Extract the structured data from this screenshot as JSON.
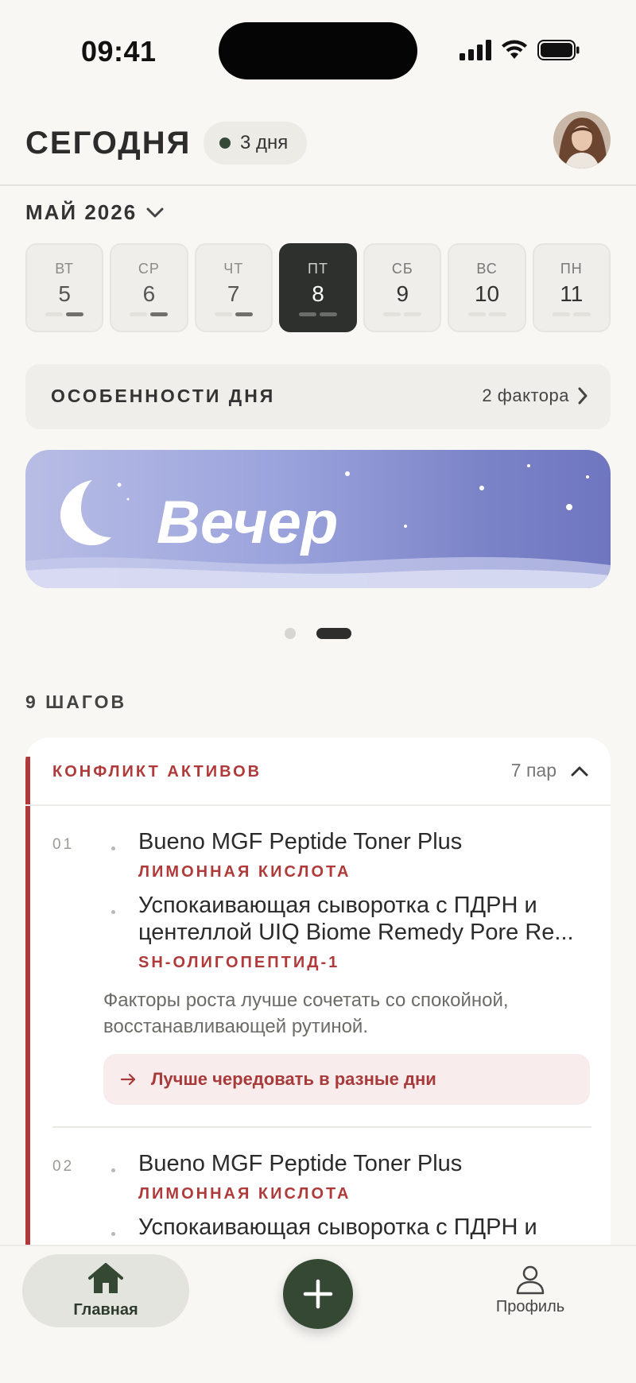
{
  "status_bar": {
    "time": "09:41"
  },
  "header": {
    "title": "СЕГОДНЯ",
    "streak": "3 дня"
  },
  "calendar": {
    "month": "МАЙ 2026",
    "days": [
      {
        "dow": "ВТ",
        "num": "5",
        "state": "past"
      },
      {
        "dow": "СР",
        "num": "6",
        "state": "past"
      },
      {
        "dow": "ЧТ",
        "num": "7",
        "state": "past"
      },
      {
        "dow": "ПТ",
        "num": "8",
        "state": "selected"
      },
      {
        "dow": "СБ",
        "num": "9",
        "state": "future"
      },
      {
        "dow": "ВС",
        "num": "10",
        "state": "future"
      },
      {
        "dow": "ПН",
        "num": "11",
        "state": "future"
      }
    ]
  },
  "features": {
    "label": "ОСОБЕННОСТИ ДНЯ",
    "count": "2 фактора"
  },
  "banner": {
    "title": "Вечер"
  },
  "pager": {
    "total": 2,
    "active": 2
  },
  "steps": {
    "label": "9 ШАГОВ",
    "conflict": {
      "label": "КОНФЛИКТ АКТИВОВ",
      "pairs": "7 пар",
      "items": [
        {
          "num": "01",
          "product_a": "Bueno MGF Peptide Toner Plus",
          "ingredient_a": "ЛИМОННАЯ КИСЛОТА",
          "product_b_line1": "Успокаивающая сыворотка с ПДРН и",
          "product_b_line2": "центеллой UIQ Biome Remedy Pore Re...",
          "ingredient_b": "SH-ОЛИГОПЕПТИД-1",
          "note_line1": "Факторы роста лучше сочетать со спокойной,",
          "note_line2": "восстанавливающей рутиной.",
          "advice": "Лучше чередовать в разные дни"
        },
        {
          "num": "02",
          "product_a": "Bueno MGF Peptide Toner Plus",
          "ingredient_a": "ЛИМОННАЯ КИСЛОТА",
          "product_b_line1": "Успокаивающая сыворотка с ПДРН и"
        }
      ]
    }
  },
  "tabbar": {
    "home": "Главная",
    "profile": "Профиль"
  },
  "colors": {
    "accent_green": "#354834",
    "conflict_red": "#b03a3a",
    "banner_start": "#b8bde5",
    "banner_end": "#6f76c0"
  }
}
